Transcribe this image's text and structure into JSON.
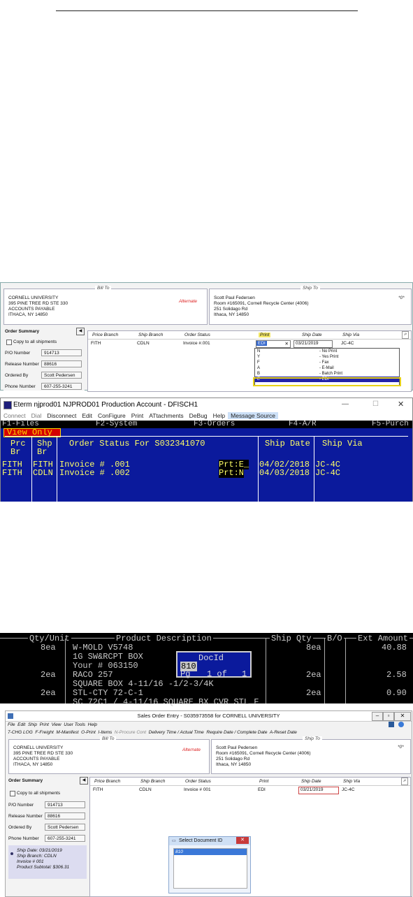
{
  "panel1": {
    "bill_to": {
      "legend": "Bill To",
      "lines": [
        "CORNELL UNIVERSITY",
        "395 PINE TREE RD STE 330",
        "ACCOUNTS PAYABLE",
        "ITHACA, NY 14850"
      ],
      "alternate": "Alternate"
    },
    "ship_to": {
      "legend": "Ship To",
      "lines": [
        "Scott Paul Federsen",
        "Room #165091, Cornell Recycle Center (4006)",
        "251 Solidago Rd",
        "Ithaca, NY 14850"
      ],
      "mark": "*0*"
    },
    "summary": {
      "title": "Order Summary",
      "copy_label": "Copy to all shipments",
      "po_label": "P/O Number",
      "po": "914713",
      "release_label": "Release Number",
      "release": "88616",
      "ordered_label": "Ordered By",
      "ordered": "Scott Pedersen",
      "phone_label": "Phone Number",
      "phone": "607-255-3241"
    },
    "grid": {
      "headers": [
        "Price Branch",
        "Ship Branch",
        "Order Status",
        "Print",
        "Ship Date",
        "Ship Via"
      ],
      "row": [
        "FITH",
        "CDLN",
        "Invoice #.001",
        "EDI",
        "03/21/2019",
        "JC-4C"
      ],
      "close": "✕"
    },
    "dropdown": [
      {
        "code": "N",
        "desc": "- No Print"
      },
      {
        "code": "Y",
        "desc": "- Yes Print"
      },
      {
        "code": "F",
        "desc": "- Fax"
      },
      {
        "code": "A",
        "desc": "- E-Mail"
      },
      {
        "code": "B",
        "desc": "- Batch Print"
      },
      {
        "code": "E",
        "desc": "- EDI"
      }
    ]
  },
  "panel2": {
    "title": "Eterm njprod01 NJPROD01 Production Account - DFISCH1",
    "menu": [
      "Connect",
      "Dial",
      "Disconnect",
      "Edit",
      "ConFigure",
      "Print",
      "ATtachments",
      "DeBug",
      "Help",
      "Message Source"
    ],
    "fkeys": [
      "F1-Files",
      "F2-System",
      "F3-Orders",
      "F4-A/R",
      "F5-Purch"
    ],
    "view_only": "View Only",
    "col_prc": "Prc",
    "col_shp": "Shp",
    "col_br1": "Br",
    "col_br2": "Br",
    "heading": "Order Status For S032341070",
    "col_ship_date": "Ship Date",
    "col_ship_via": "Ship Via",
    "rows": [
      {
        "prc": "FITH",
        "shp": "FITH",
        "status": "Invoice # .001",
        "prt": "Prt:E_",
        "date": "04/02/2018",
        "via": "JC-4C"
      },
      {
        "prc": "FITH",
        "shp": "CDLN",
        "status": "Invoice # .002",
        "prt": "Prt:N",
        "date": "04/03/2018",
        "via": "JC-4C"
      }
    ],
    "min": "—",
    "max": "☐",
    "close": "✕"
  },
  "panel3": {
    "headers": [
      "Qty/Unit",
      "Product Description",
      "Ship Qty",
      "B/O",
      "Ext Amount"
    ],
    "lines": [
      {
        "qty": "8ea",
        "desc": "W-MOLD V5748",
        "ship": "8ea",
        "amt": "40.88"
      },
      {
        "qty": "",
        "desc": "1G SW&RCPT BOX",
        "ship": "",
        "amt": ""
      },
      {
        "qty": "",
        "desc": "Your # 063150",
        "ship": "",
        "amt": ""
      },
      {
        "qty": "2ea",
        "desc": "RACO 257",
        "ship": "2ea",
        "amt": "2.58"
      },
      {
        "qty": "",
        "desc": "SQUARE BOX 4-11/16 -1/2-3/4K",
        "ship": "",
        "amt": ""
      },
      {
        "qty": "2ea",
        "desc": "STL-CTY 72-C-1",
        "ship": "2ea",
        "amt": "0.90"
      },
      {
        "qty": "",
        "desc": "SC 72C1 / 4-11/16 SQUARE BX CVR STL F",
        "ship": "",
        "amt": ""
      }
    ],
    "popup": {
      "title": "DocId",
      "value": "810",
      "pg": "Pg",
      "pg_info": "1 of",
      "pg_total": "1"
    }
  },
  "panel4": {
    "title": "Sales Order Entry - S035973558 for CORNELL UNIVERSITY",
    "menu": [
      "File",
      "Edit",
      "Ship",
      "Print",
      "View",
      "User Tools",
      "Help"
    ],
    "toolbar": [
      "7-CHG LOG",
      "F-Freight",
      "M-Manifest",
      "O-Print",
      "I-Items",
      "N-Procure Cont",
      "Delivery Time / Actual Time",
      "Require Date / Complete Date",
      "A-Reset Date"
    ],
    "bill_to": {
      "legend": "Bill To",
      "lines": [
        "CORNELL UNIVERSITY",
        "395 PINE TREE RD STE 330",
        "ACCOUNTS PAYABLE",
        "ITHACA, NY 14850"
      ],
      "alternate": "Alternate"
    },
    "ship_to": {
      "legend": "Ship To",
      "lines": [
        "Scott Paul Pedersen",
        "Room #165091, Cornell Recycle Center (4006)",
        "251 Solidago Rd",
        "Ithaca, NY 14850"
      ],
      "mark": "*0*"
    },
    "summary": {
      "title": "Order Summary",
      "copy_label": "Copy to all shipments",
      "po_label": "P/O Number",
      "po": "914713",
      "release_label": "Release Number",
      "release": "88616",
      "ordered_label": "Ordered By",
      "ordered": "Scott Pedersen",
      "phone_label": "Phone Number",
      "phone": "607-255-3241"
    },
    "ship_card": {
      "date": "Ship Date: 03/21/2019",
      "branch": "Ship Branch: CDLN",
      "invoice": "Invoice # 001",
      "subtotal": "Product Subtotal: $306.31"
    },
    "grid": {
      "headers": [
        "Price Branch",
        "Ship Branch",
        "Order Status",
        "Print",
        "Ship Date",
        "Ship Via"
      ],
      "row": [
        "FITH",
        "CDLN",
        "Invoice # 001",
        "EDI",
        "03/21/2019",
        "JC-4C"
      ]
    },
    "dialog": {
      "title": "Select Document ID",
      "item": "810",
      "close": "✕"
    }
  }
}
